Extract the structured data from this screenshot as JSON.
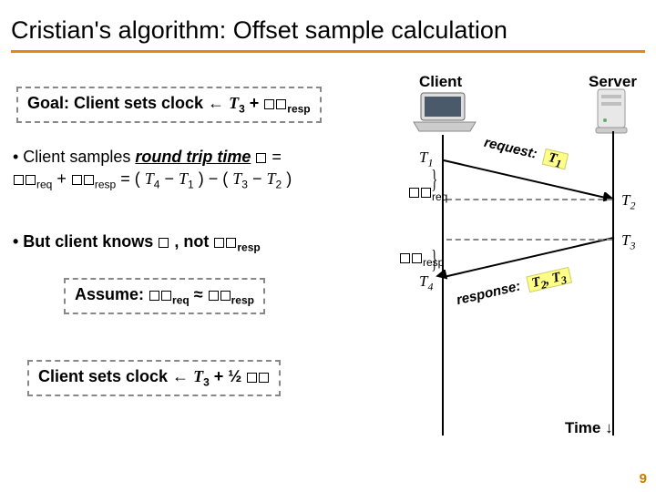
{
  "title": "Cristian's algorithm: Offset sample calculation",
  "goal": {
    "prefix": "Goal: Client sets clock ← ",
    "term": "T",
    "sub": "3",
    "plus": " + ",
    "deltaSub": "resp"
  },
  "bullet1": {
    "lead": "•  Client samples ",
    "rtt": "round trip time",
    "eq1": " =",
    "line2a": " + ",
    "sub_req": "req",
    "sub_resp": "resp",
    "eq2": " = (",
    "T": "T",
    "s4": "4",
    "minus": " − ",
    "s1": "1",
    "close": ") − (",
    "s3": "3",
    "s2": "2",
    "end": ")"
  },
  "bullet2": {
    "lead": "•  But client knows ",
    "mid": ", not ",
    "sub_resp": "resp"
  },
  "assume": {
    "label": "Assume: ",
    "approx": " ≈ ",
    "sub_req": "req",
    "sub_resp": "resp"
  },
  "final": {
    "prefix": "Client sets clock ← ",
    "T": "T",
    "sub3": "3",
    "plus": " + ½"
  },
  "diagram": {
    "client": "Client",
    "server": "Server",
    "T": "T",
    "s1": "1",
    "s2": "2",
    "s3": "3",
    "s4": "4",
    "request": "request:",
    "response": "response:",
    "reqPayload": "T",
    "reqPayloadSub": "1",
    "respPayload1": "T",
    "respPayloadSub1": "2",
    "comma": ", ",
    "respPayload2": "T",
    "respPayloadSub2": "3",
    "deltaSubReq": "req",
    "deltaSubResp": "resp",
    "time": "Time ↓"
  },
  "page": "9"
}
